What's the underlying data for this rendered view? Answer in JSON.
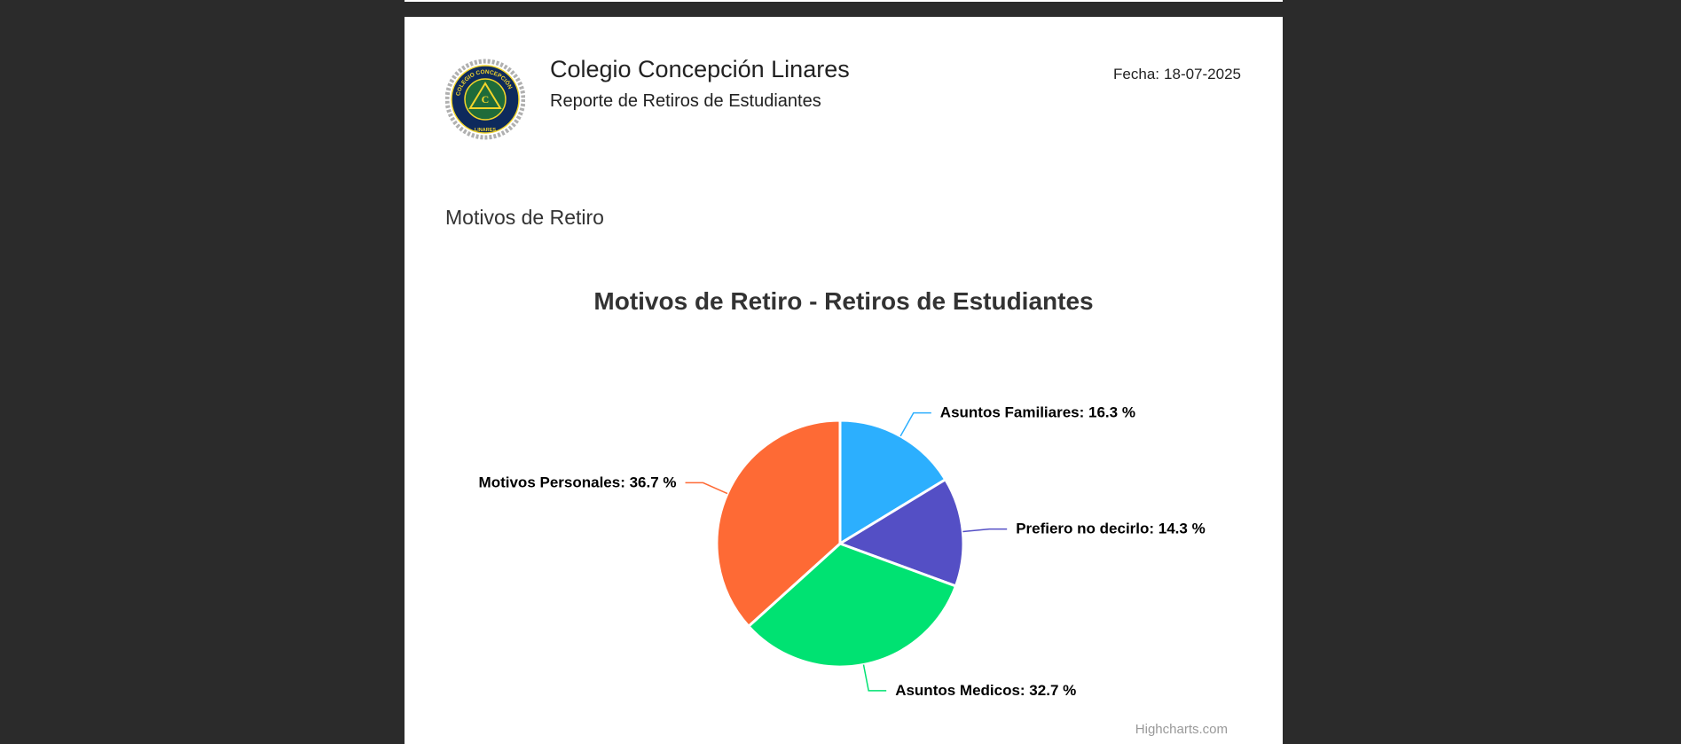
{
  "header": {
    "school_name": "Colegio Concepción Linares",
    "report_title": "Reporte de Retiros de Estudiantes",
    "date_label": "Fecha:",
    "date_value": "18-07-2025"
  },
  "logo": {
    "ring_text": "COLEGIO CONCEPCIÓN",
    "inner_text": "LINARES",
    "colors": {
      "navy": "#0e2a5c",
      "yellow": "#f2d52b",
      "green": "#1f6b3a",
      "chain": "#b0b0b0"
    }
  },
  "section": {
    "title": "Motivos de Retiro"
  },
  "credits": "Highcharts.com",
  "chart_data": {
    "type": "pie",
    "title": "Motivos de Retiro - Retiros de Estudiantes",
    "label_format": "{name}: {value} %",
    "slices": [
      {
        "name": "Asuntos Familiares",
        "value": 16.3,
        "color": "#2caffe"
      },
      {
        "name": "Prefiero no decirlo",
        "value": 14.3,
        "color": "#544fc5"
      },
      {
        "name": "Asuntos Medicos",
        "value": 32.7,
        "color": "#00e272"
      },
      {
        "name": "Motivos Personales",
        "value": 36.7,
        "color": "#fe6a35"
      }
    ]
  }
}
